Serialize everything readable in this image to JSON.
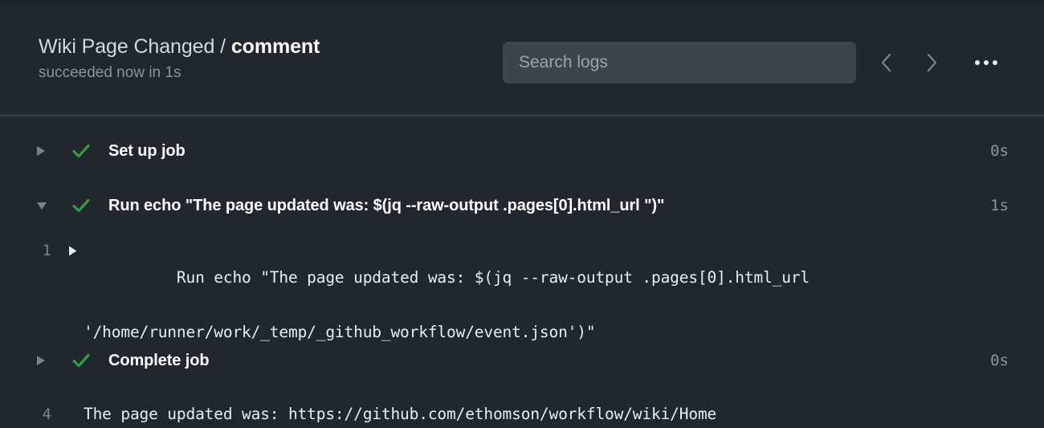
{
  "header": {
    "job_name": "Wiki Page Changed",
    "separator": "/",
    "step_name": "comment",
    "status": "succeeded now in 1s",
    "search_placeholder": "Search logs",
    "search_value": "",
    "prev_icon": "chevron-left-icon",
    "next_icon": "chevron-right-icon",
    "menu_icon": "kebab-menu-icon"
  },
  "steps": [
    {
      "label": "Set up job",
      "duration": "0s",
      "expanded": false,
      "status_icon": "check-icon"
    },
    {
      "label": "Run echo \"The page updated was: $(jq --raw-output .pages[0].html_url \")\"",
      "duration": "1s",
      "expanded": true,
      "status_icon": "check-icon",
      "lines": [
        {
          "number": "1",
          "has_toggle": true,
          "text": "Run echo \"The page updated was: $(jq --raw-output .pages[0].html_url",
          "continuation": "'/home/runner/work/_temp/_github_workflow/event.json')\""
        },
        {
          "number": "4",
          "has_toggle": false,
          "text": "The page updated was: https://github.com/ethomson/workflow/wiki/Home",
          "continuation": ""
        }
      ]
    },
    {
      "label": "Complete job",
      "duration": "0s",
      "expanded": false,
      "status_icon": "check-icon"
    }
  ],
  "colors": {
    "background": "#22272e",
    "header_border": "#373e47",
    "success_green": "#2ea043",
    "muted_text": "#8b949e",
    "search_bg": "#3d444d"
  }
}
